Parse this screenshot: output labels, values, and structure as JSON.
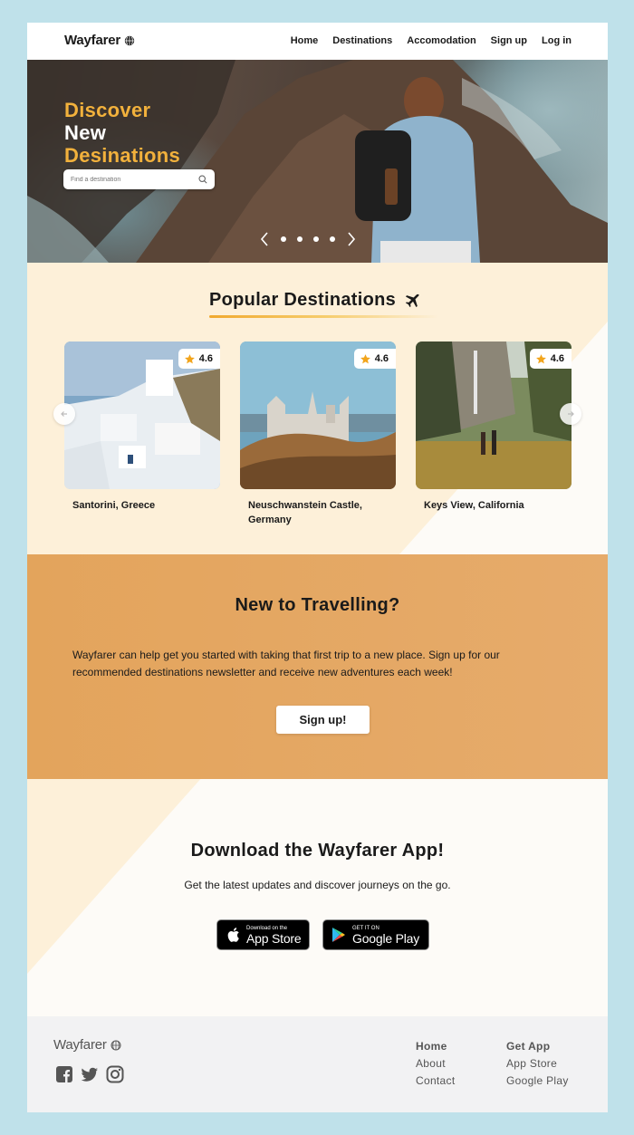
{
  "header": {
    "logo": "Wayfarer",
    "nav": [
      "Home",
      "Destinations",
      "Accomodation",
      "Sign up",
      "Log in"
    ]
  },
  "hero": {
    "title_line1": "Discover",
    "title_line2": "New",
    "title_line3": "Desinations",
    "search_placeholder": "Find a destination",
    "slide_count": 4
  },
  "popular": {
    "title": "Popular Destinations",
    "cards": [
      {
        "name": "Santorini, Greece",
        "rating": "4.6"
      },
      {
        "name": "Neuschwanstein Castle, Germany",
        "rating": "4.6"
      },
      {
        "name": "Keys View, California",
        "rating": "4.6"
      }
    ]
  },
  "newtravel": {
    "title": "New to Travelling?",
    "text": "Wayfarer can help get you started with taking that first trip to a new place. Sign up for our recommended destinations newsletter and receive new adventures each week!",
    "button": "Sign up!"
  },
  "download": {
    "title": "Download the Wayfarer App!",
    "subtitle": "Get the latest updates and discover journeys on the go.",
    "appstore_small": "Download on the",
    "appstore_big": "App Store",
    "gplay_small": "GET IT ON",
    "gplay_big": "Google Play"
  },
  "footer": {
    "logo": "Wayfarer",
    "col1": [
      "Home",
      "About",
      "Contact"
    ],
    "col2": [
      "Get App",
      "App Store",
      "Google Play"
    ]
  },
  "colors": {
    "accent": "#f2b13c",
    "orange_band": "#e3a45c",
    "cream": "#fdf0d9",
    "bg": "#bfe1ea"
  }
}
